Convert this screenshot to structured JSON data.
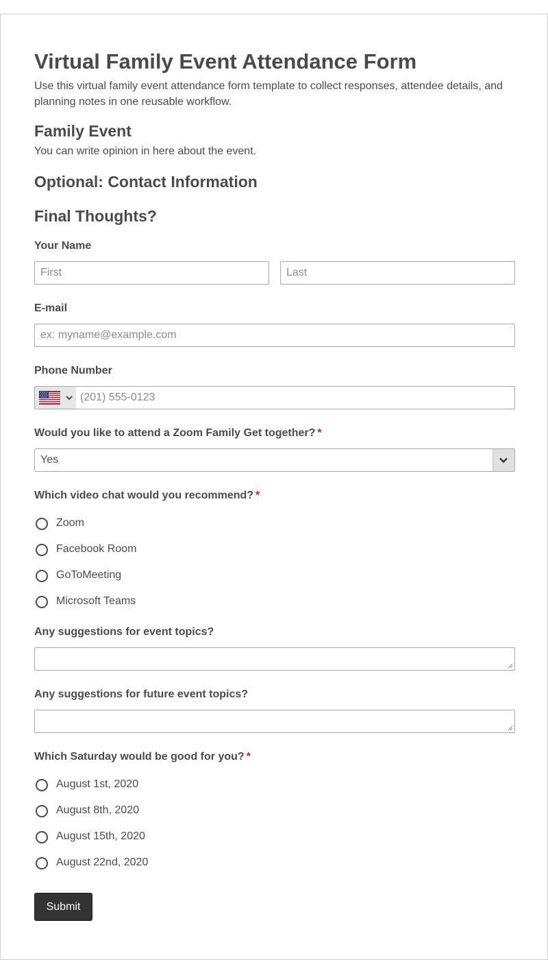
{
  "form": {
    "title": "Virtual Family Event Attendance Form",
    "description": "Use this virtual family event attendance form template to collect responses, attendee details, and planning notes in one reusable workflow."
  },
  "sections": {
    "family_event": {
      "heading": "Family Event",
      "subheading": "You can write opinion in here about the event."
    },
    "contact_heading": "Optional: Contact Information",
    "final_heading": "Final Thoughts?"
  },
  "fields": {
    "name": {
      "label": "Your Name",
      "first_placeholder": "First",
      "last_placeholder": "Last",
      "first_value": "",
      "last_value": ""
    },
    "email": {
      "label": "E-mail",
      "placeholder": "ex: myname@example.com",
      "value": ""
    },
    "phone": {
      "label": "Phone Number",
      "placeholder": "(201) 555-0123",
      "country_icon": "us-flag-icon",
      "value": ""
    },
    "attend": {
      "label": "Would you like to attend a Zoom Family Get together?",
      "required_mark": "*",
      "selected": "Yes"
    },
    "video_chat": {
      "label": "Which video chat would you recommend?",
      "required_mark": "*",
      "options": [
        "Zoom",
        "Facebook Room",
        "GoToMeeting",
        "Microsoft Teams"
      ]
    },
    "topics": {
      "label": "Any suggestions for event topics?",
      "value": ""
    },
    "future_topics": {
      "label": "Any suggestions for future event topics?",
      "value": ""
    },
    "saturday": {
      "label": "Which Saturday would be good for you?",
      "required_mark": "*",
      "options": [
        "August 1st, 2020",
        "August 8th, 2020",
        "August 15th, 2020",
        "August 22nd, 2020"
      ]
    }
  },
  "submit_label": "Submit",
  "colors": {
    "text": "#4a4a4a",
    "required": "#c51f1f",
    "submit_bg": "#333333",
    "border": "#a8a8a8"
  }
}
